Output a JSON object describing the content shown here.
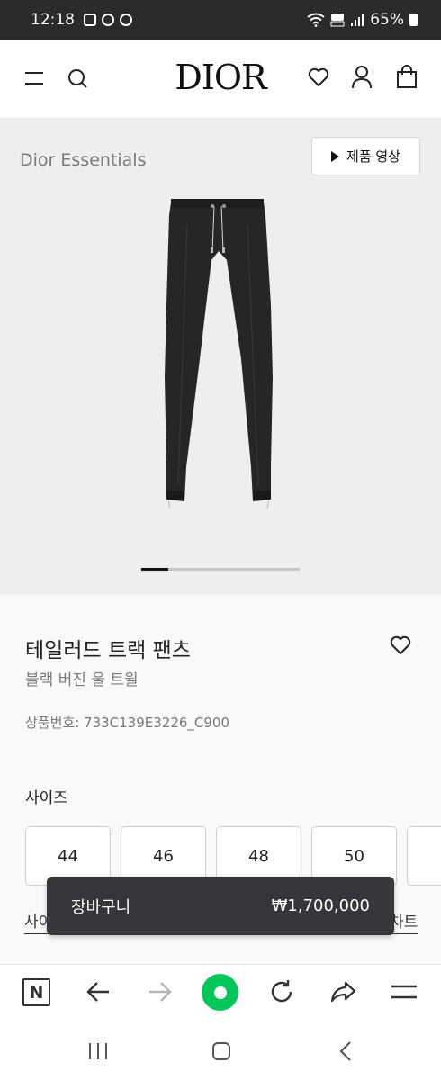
{
  "status_bar": {
    "time": "12:18",
    "battery_percent": "65%",
    "left_icons": [
      "gallery-icon",
      "chrome-icon",
      "chrome-icon"
    ],
    "right_icons": [
      "wifi-icon",
      "volte-icon",
      "signal-icon",
      "battery-icon"
    ]
  },
  "header": {
    "logo": "DIOR",
    "icons": [
      "menu-icon",
      "search-icon",
      "heart-icon",
      "user-icon",
      "bag-icon"
    ]
  },
  "hero": {
    "collection_label": "Dior Essentials",
    "video_button_label": "제품 영상",
    "carousel_progress": 0.17
  },
  "product": {
    "name": "테일러드 트랙 팬츠",
    "subtitle": "블랙 버진 울 트윌",
    "code": "상품번호: 733C139E3226_C900"
  },
  "size_section": {
    "title": "사이즈",
    "options": [
      "44",
      "46",
      "48",
      "50",
      ""
    ],
    "guide_link": "사이",
    "chart_link": "차트"
  },
  "cart": {
    "label": "장바구니",
    "price": "₩1,700,000"
  },
  "browser_toolbar": {
    "n_label": "N",
    "icons": [
      "naver-n-icon",
      "back-arrow-icon",
      "forward-arrow-icon",
      "home-green-icon",
      "reload-icon",
      "share-icon",
      "menu-lines-icon"
    ]
  },
  "system_nav": {
    "icons": [
      "recents-icon",
      "home-icon",
      "back-icon"
    ]
  },
  "colors": {
    "status_bar_bg": "#2b2b2b",
    "hero_bg": "#eeeeee",
    "cart_bar_bg": "#34363a",
    "accent_green": "#03c75a"
  }
}
